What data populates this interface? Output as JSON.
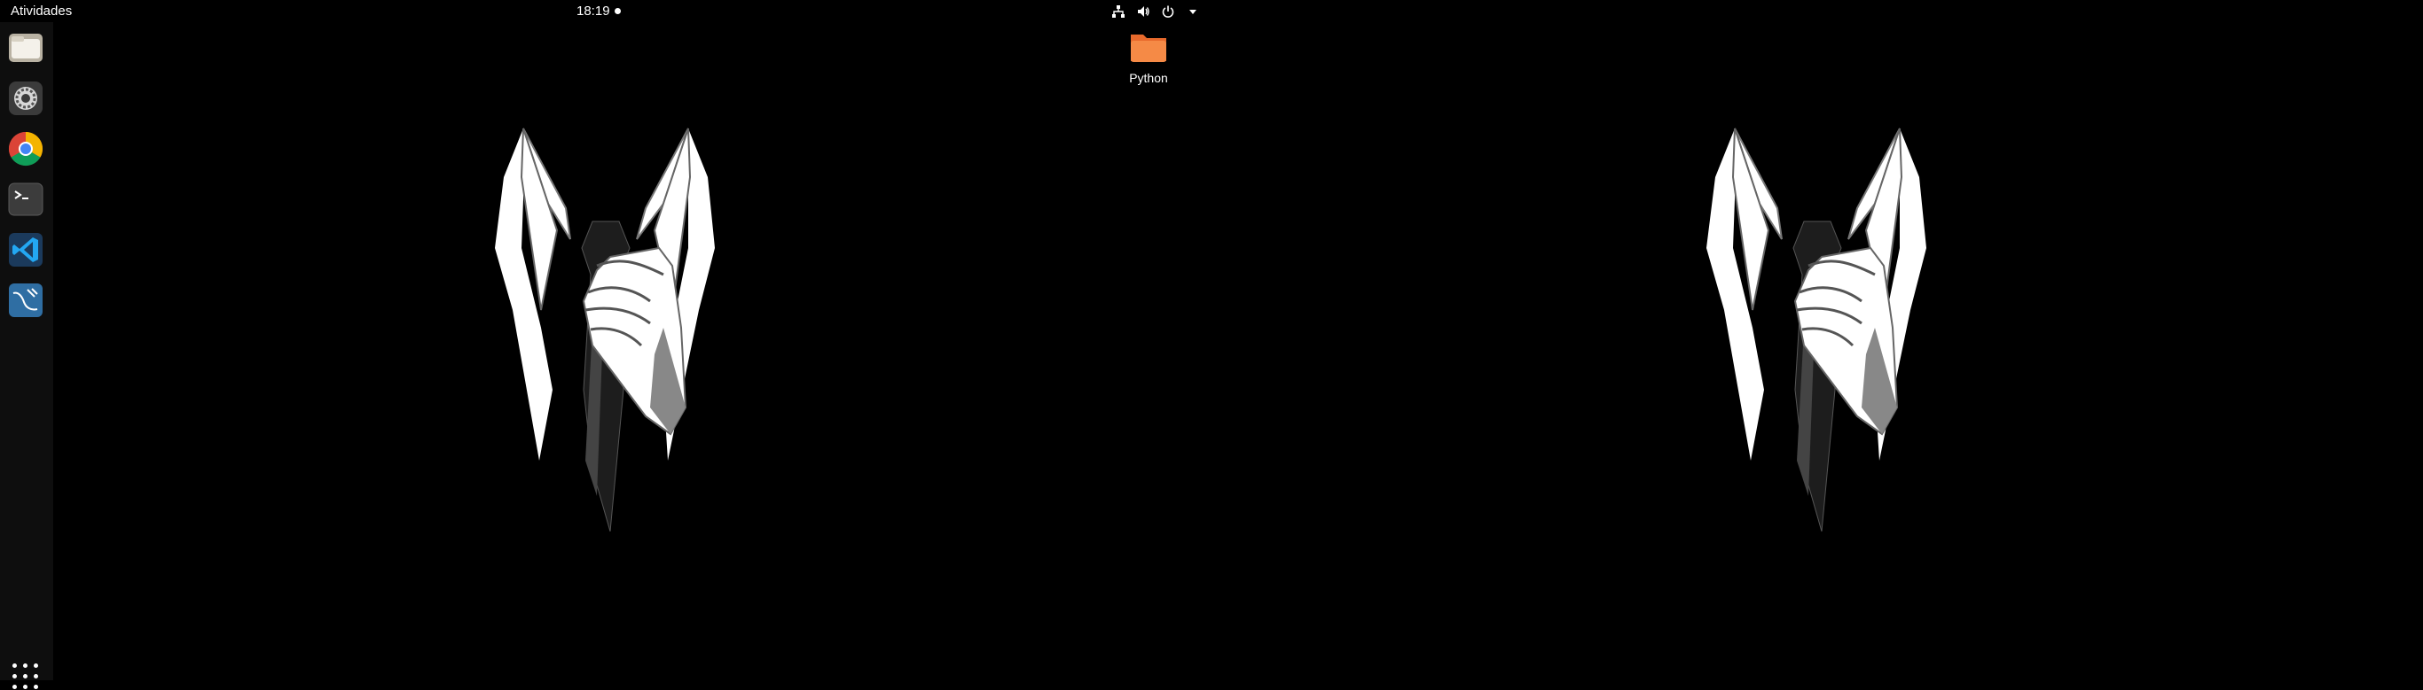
{
  "topbar": {
    "activities_label": "Atividades",
    "clock": "18:19"
  },
  "dock": {
    "apps": [
      {
        "name": "Files"
      },
      {
        "name": "Settings"
      },
      {
        "name": "Chrome"
      },
      {
        "name": "Terminal"
      },
      {
        "name": "Visual Studio Code"
      },
      {
        "name": "MySQL Workbench"
      }
    ]
  },
  "desktop": {
    "icons": [
      {
        "label": "Python",
        "icon": "folder-icon",
        "color": "#f07a3a"
      }
    ]
  },
  "colors": {
    "panel": "#000000",
    "dock": "#0e0e0e",
    "accent_folder": "#f07a3a"
  }
}
